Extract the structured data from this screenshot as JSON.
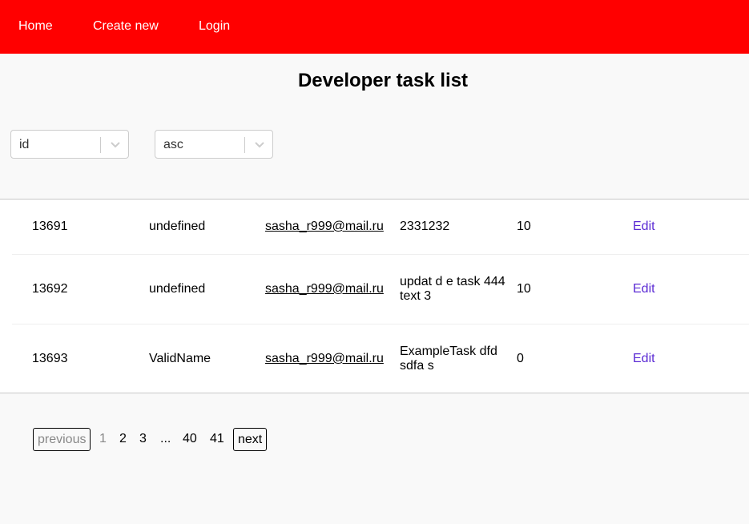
{
  "nav": {
    "home": "Home",
    "create_new": "Create new",
    "login": "Login",
    "background": "#ff0000"
  },
  "page_title": "Developer task list",
  "sort": {
    "field": "id",
    "order": "asc"
  },
  "tasks": [
    {
      "id": "13691",
      "username": "undefined",
      "email": "sasha_r999@mail.ru",
      "text": "2331232",
      "status": "10",
      "action": "Edit"
    },
    {
      "id": "13692",
      "username": "undefined",
      "email": "sasha_r999@mail.ru",
      "text": "updat d e task 444 text 3",
      "status": "10",
      "action": "Edit"
    },
    {
      "id": "13693",
      "username": "ValidName",
      "email": "sasha_r999@mail.ru",
      "text": "ExampleTask dfd sdfa s",
      "status": "0",
      "action": "Edit"
    }
  ],
  "pagination": {
    "previous": "previous",
    "pages": [
      "1",
      "2",
      "3",
      "...",
      "40",
      "41"
    ],
    "current": "1",
    "next": "next"
  },
  "colors": {
    "accent": "#ff0000",
    "link": "#5b2bd4"
  }
}
